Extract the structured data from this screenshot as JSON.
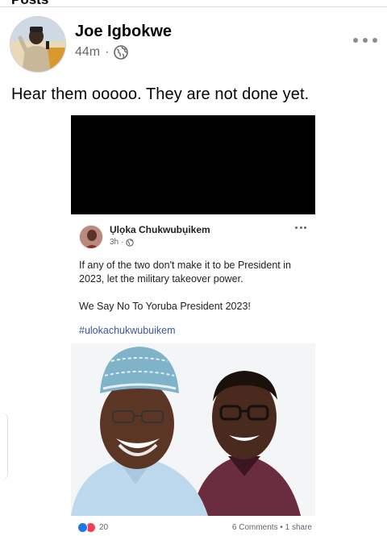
{
  "top_section": {
    "title": "Posts"
  },
  "post": {
    "author": "Joe Igbokwe",
    "time": "44m",
    "separator": "·",
    "privacy_icon": "globe-icon",
    "menu_icon": "more-horizontal-icon",
    "text": "Hear them ooooo. They are not done yet."
  },
  "shared_post": {
    "author": "Ụlọka Chukwubụikem",
    "time": "3h",
    "separator": "·",
    "privacy_icon": "globe-icon",
    "menu_icon": "more-horizontal-icon",
    "paragraph_1": "If any of the two don't make it to be President in 2023, let the military takeover power.",
    "paragraph_2": "We Say No To Yoruba President 2023!",
    "hashtag": "#ulokachukwubuikem",
    "reaction_count": "20",
    "comments_shares": "6 Comments • 1 share",
    "reaction_icons": [
      "like-icon",
      "love-icon"
    ],
    "colors": {
      "like": "#1877f2",
      "love": "#f33e58",
      "hashtag": "#385898"
    }
  },
  "colors": {
    "text": "#050505",
    "muted": "#65676b",
    "redaction": "#000000"
  }
}
